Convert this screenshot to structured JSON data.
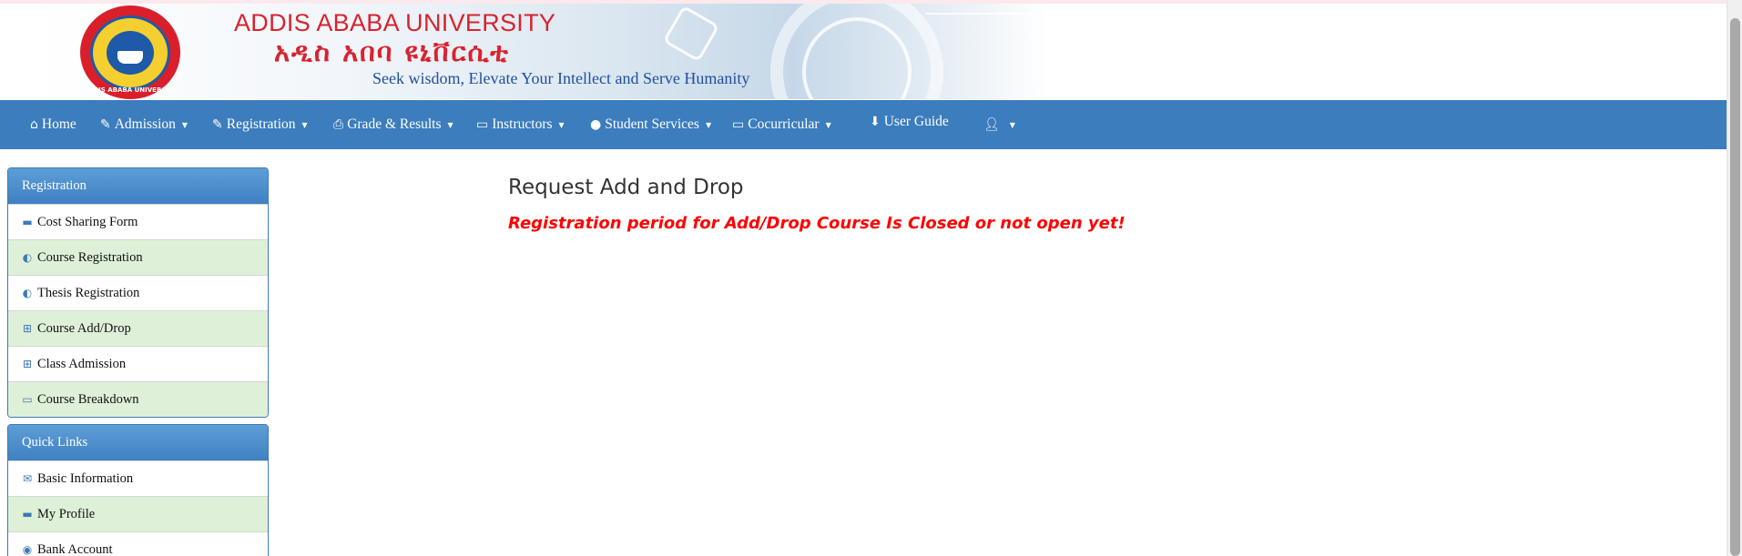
{
  "banner": {
    "university_en": "ADDIS ABABA UNIVERSITY",
    "university_am": "አዲስ አበባ ዩኒቨርሲቲ",
    "motto": "Seek wisdom, Elevate Your Intellect and Serve Humanity",
    "logo_ring_text": "ADDIS ABABA UNIVERSITY"
  },
  "colors": {
    "navbar": "#3b7dbd",
    "panel_heading": "#4a8bcb",
    "alt_row": "#dff0d8",
    "alert": "#ff0000",
    "brand_red": "#d8232f"
  },
  "navbar": {
    "items": [
      {
        "label": "Home",
        "icon": "home-icon",
        "dropdown": false
      },
      {
        "label": "Admission",
        "icon": "edit-icon",
        "dropdown": true
      },
      {
        "label": "Registration",
        "icon": "edit-icon",
        "dropdown": true
      },
      {
        "label": "Grade & Results",
        "icon": "print-icon",
        "dropdown": true
      },
      {
        "label": "Instructors",
        "icon": "folder-open-icon",
        "dropdown": true
      },
      {
        "label": "Student Services",
        "icon": "tint-icon",
        "dropdown": true
      },
      {
        "label": "Cocurricular",
        "icon": "folder-open-icon",
        "dropdown": true
      },
      {
        "label": "User Guide",
        "icon": "download-icon",
        "dropdown": false
      },
      {
        "label": "",
        "icon": "user-icon",
        "dropdown": true
      }
    ]
  },
  "sidebar": {
    "registration": {
      "heading": "Registration",
      "items": [
        {
          "label": "Cost Sharing Form",
          "icon": "briefcase-icon"
        },
        {
          "label": "Course Registration",
          "icon": "adjust-icon"
        },
        {
          "label": "Thesis Registration",
          "icon": "adjust-icon"
        },
        {
          "label": "Course Add/Drop",
          "icon": "plus-square-icon"
        },
        {
          "label": "Class Admission",
          "icon": "plus-square-icon"
        },
        {
          "label": "Course Breakdown",
          "icon": "folder-open-icon"
        }
      ]
    },
    "quick_links": {
      "heading": "Quick Links",
      "items": [
        {
          "label": "Basic Information",
          "icon": "envelope-icon"
        },
        {
          "label": "My Profile",
          "icon": "briefcase-icon"
        },
        {
          "label": "Bank Account",
          "icon": "eye-icon"
        }
      ]
    }
  },
  "main": {
    "title": "Request Add and Drop",
    "alert": "Registration period for Add/Drop Course Is Closed or not open yet!"
  }
}
